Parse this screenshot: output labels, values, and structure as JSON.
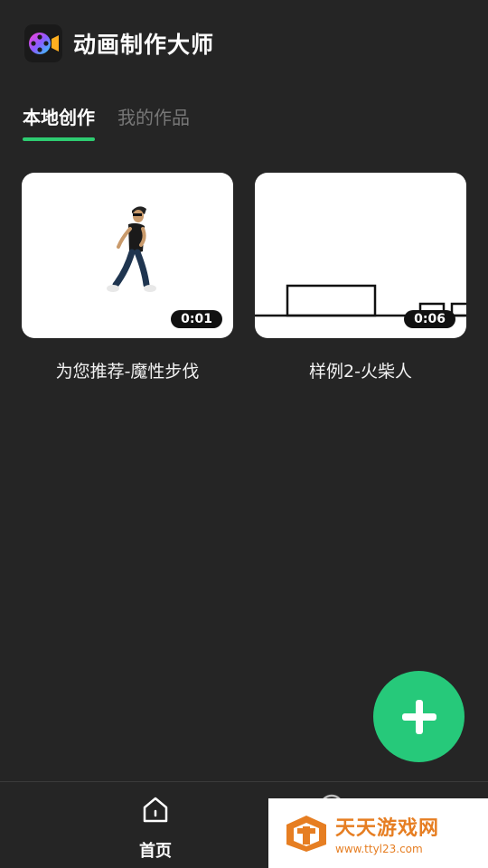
{
  "app": {
    "title": "动画制作大师",
    "icon": "film-reel-icon"
  },
  "tabs": [
    {
      "label": "本地创作",
      "active": true
    },
    {
      "label": "我的作品",
      "active": false
    }
  ],
  "cards": [
    {
      "title": "为您推荐-魔性步伐",
      "duration": "0:01"
    },
    {
      "title": "样例2-火柴人",
      "duration": "0:06"
    }
  ],
  "fab": {
    "icon": "plus-icon"
  },
  "nav": {
    "home_label": "首页",
    "home_icon": "home-icon"
  },
  "watermark": {
    "main": "天天游戏网",
    "sub": "www.ttyl23.com"
  },
  "colors": {
    "accent": "#26c97a",
    "background": "#252525",
    "watermark": "#e67e22"
  }
}
